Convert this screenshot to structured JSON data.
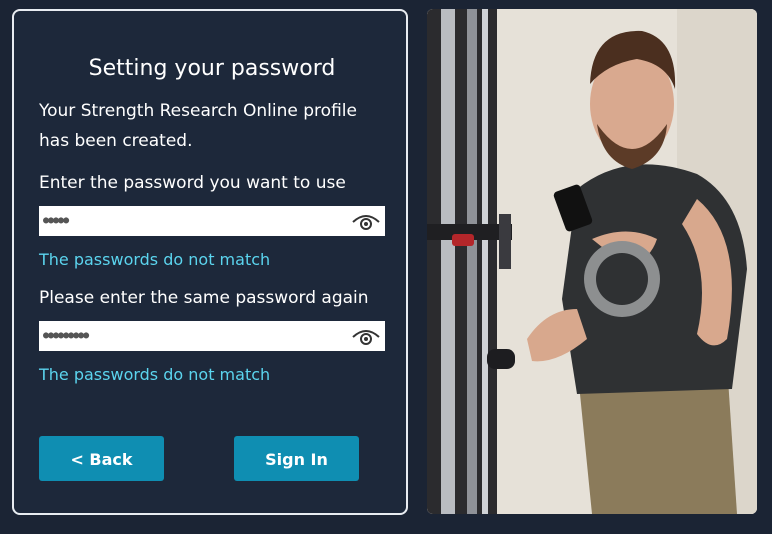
{
  "form": {
    "title": "Setting your password",
    "message": "Your Strength Research Online profile has been created.",
    "password_label": "Enter the password you want to use",
    "password_value": "●●●●●",
    "password_error": "The passwords do not match",
    "confirm_label": "Please enter the same password again",
    "confirm_value": "●●●●●●●●●",
    "confirm_error": "The passwords do not match",
    "back_label": "< Back",
    "signin_label": "Sign In"
  },
  "icons": {
    "password_toggle": "eye-icon",
    "confirm_toggle": "eye-icon"
  },
  "colors": {
    "background": "#1b2434",
    "card_border": "#e8ecf1",
    "error_text": "#5bd4ee",
    "button": "#0f8eb2"
  }
}
